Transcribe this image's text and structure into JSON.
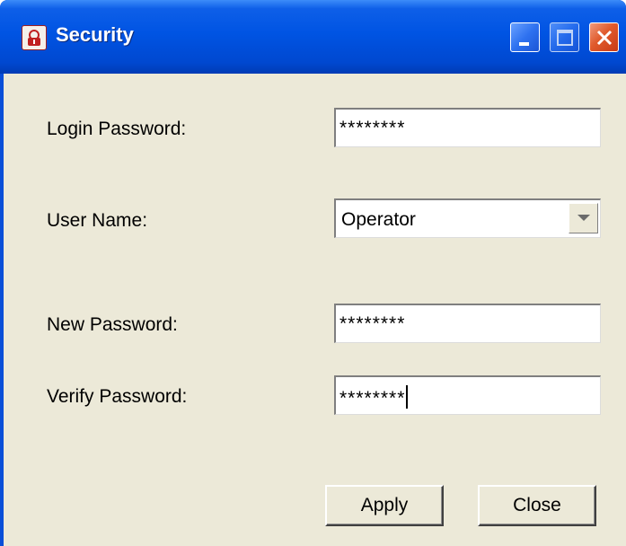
{
  "window": {
    "title": "Security",
    "icon": "security-app-icon",
    "controls": [
      "minimize-icon",
      "maximize-icon",
      "close-icon"
    ]
  },
  "form": {
    "login_password": {
      "label": "Login Password:",
      "value": "********"
    },
    "user_name": {
      "label": "User Name:",
      "selected": "Operator"
    },
    "new_password": {
      "label": "New Password:",
      "value": "********"
    },
    "verify_password": {
      "label": "Verify Password:",
      "value": "********"
    }
  },
  "buttons": {
    "apply": "Apply",
    "close": "Close"
  },
  "colors": {
    "titlebar": "#0054e3",
    "client_background": "#ece9d8",
    "close_button": "#e05a2c"
  }
}
